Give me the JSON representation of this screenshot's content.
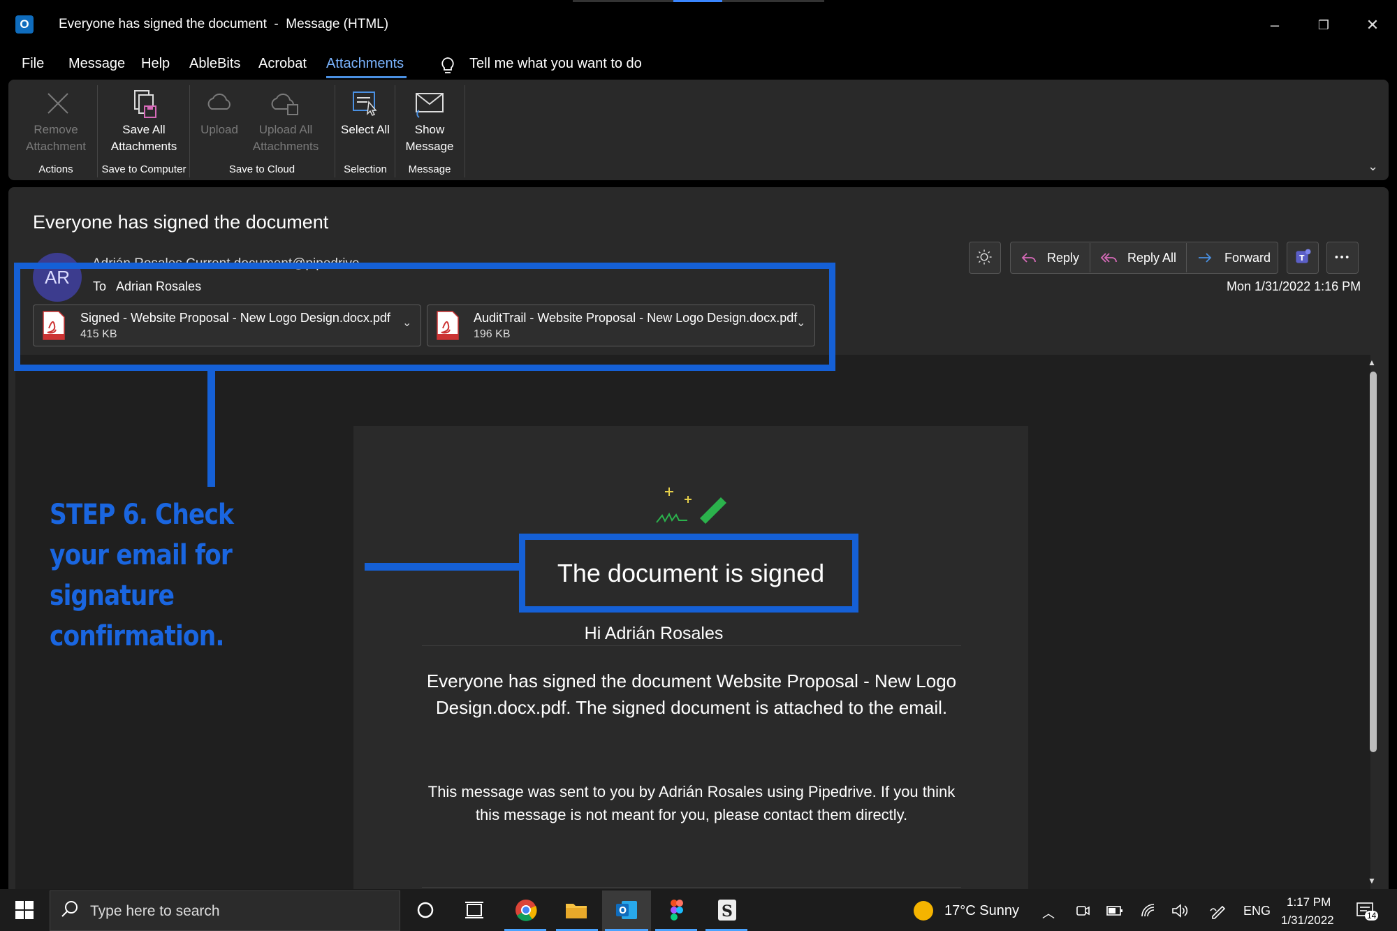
{
  "window": {
    "title": "Everyone has signed the document  -  Message (HTML)",
    "app_icon_letter": "O",
    "minimize": "–",
    "restore": "❐",
    "close": "✕"
  },
  "menu": {
    "items": [
      "File",
      "Message",
      "Help",
      "AbleBits",
      "Acrobat",
      "Attachments"
    ],
    "active": "Attachments",
    "tell_me": "Tell me what you want to do"
  },
  "ribbon": {
    "buttons": {
      "remove": "Remove Attachment",
      "save_all": "Save All Attachments",
      "upload": "Upload",
      "upload_all": "Upload All Attachments",
      "select_all": "Select All",
      "show_message": "Show Message"
    },
    "groups": {
      "actions": "Actions",
      "save_to_computer": "Save to Computer",
      "save_to_cloud": "Save to Cloud",
      "selection": "Selection",
      "message": "Message"
    },
    "collapse_icon": "chevron-down-icon"
  },
  "message": {
    "subject": "Everyone has signed the document",
    "avatar_initials": "AR",
    "sender_partial": "Adrián Rosales Current document@pipedrive",
    "to_label": "To",
    "to_name": "Adrian Rosales",
    "date": "Mon 1/31/2022 1:16 PM",
    "actions": {
      "reply": "Reply",
      "reply_all": "Reply All",
      "forward": "Forward"
    },
    "attachments": [
      {
        "name": "Signed - Website Proposal - New Logo Design.docx.pdf",
        "size": "415 KB",
        "icon": "pdf-icon"
      },
      {
        "name": "AuditTrail - Website Proposal - New Logo Design.docx.pdf",
        "size": "196 KB",
        "icon": "pdf-icon"
      }
    ]
  },
  "email_body": {
    "heading": "The document is signed",
    "greeting": "Hi Adrián Rosales",
    "text": "Everyone has signed the document Website Proposal - New Logo Design.docx.pdf. The signed document is attached to the email.",
    "footer": "This message was sent to you by Adrián Rosales            using Pipedrive. If you think this message is not meant for you, please contact them directly."
  },
  "annotation": {
    "text": "STEP 6. Check your email for signature confirmation.",
    "color": "#1560d6"
  },
  "taskbar": {
    "search_placeholder": "Type here to search",
    "weather": "17°C  Sunny",
    "language": "ENG",
    "time": "1:17 PM",
    "date": "1/31/2022",
    "notification_count": "14",
    "pinned": [
      "cortana-icon",
      "task-view-icon",
      "chrome-icon",
      "file-explorer-icon",
      "outlook-icon",
      "figma-icon",
      "scrivener-icon"
    ]
  },
  "colors": {
    "accent": "#4a90e2",
    "background": "#292929",
    "annotation": "#1560d6"
  }
}
